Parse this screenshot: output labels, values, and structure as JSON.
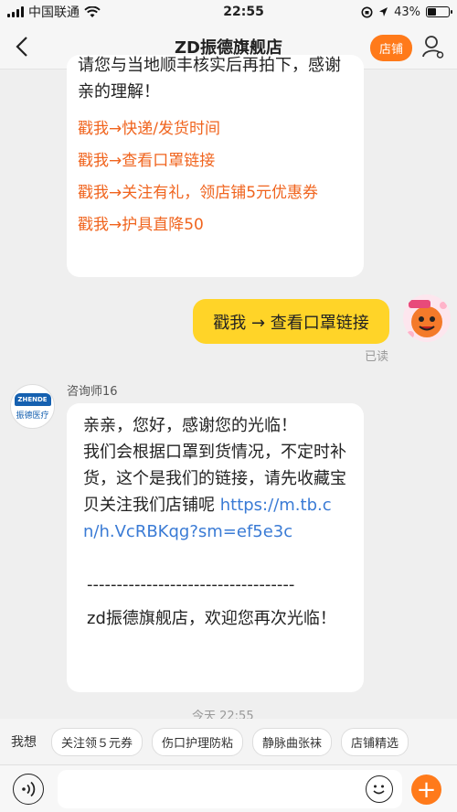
{
  "status_bar": {
    "carrier": "中国联通",
    "time": "22:55",
    "battery": "43%",
    "battery_level": 0.43
  },
  "nav": {
    "title": "ZD振德旗舰店",
    "shop_button": "店铺"
  },
  "top_bubble": {
    "partial_text": "请您与当地顺丰核实后再拍下，感谢亲的理解！",
    "links": [
      "戳我→快递/发货时间",
      "戳我→查看口罩链接",
      "戳我→关注有礼，领店铺5元优惠券",
      "戳我→护具直降50"
    ]
  },
  "my_message": {
    "text": "戳我 → 查看口罩链接",
    "status": "已读"
  },
  "agent": {
    "name": "咨询师16",
    "logo_text": "ZHENDE",
    "logo_sub": "振德医疗"
  },
  "reply": {
    "greeting": "亲亲，您好，感谢您的光临！",
    "body": "我们会根据口罩到货情况，不定时补货，这个是我们的链接，请先收藏宝贝关注我们店铺呢",
    "url": "https://m.tb.cn/h.VcRBKqg?sm=ef5e3c",
    "divider": "-----------------------------------",
    "signature": "zd振德旗舰店，欢迎您再次光临！"
  },
  "peek_time": "今天 22:55",
  "quick_bar": {
    "label": "我想",
    "chips": [
      "关注领５元券",
      "伤口护理防粘",
      "静脉曲张袜",
      "店铺精选"
    ]
  },
  "input": {
    "placeholder": ""
  },
  "colors": {
    "accent": "#ff7a1a",
    "link": "#f0641e",
    "url": "#3a7bd5",
    "my_bubble": "#ffd428"
  }
}
